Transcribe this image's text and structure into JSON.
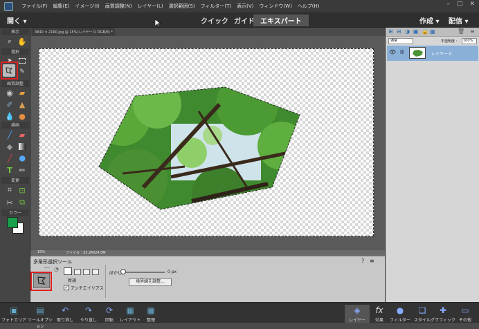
{
  "menubar": {
    "items": [
      "ファイル(F)",
      "編集(E)",
      "イメージ(I)",
      "画質調整(N)",
      "レイヤー(L)",
      "選択範囲(S)",
      "フィルター(T)",
      "表示(V)",
      "ウィンドウ(W)",
      "ヘルプ(H)"
    ]
  },
  "modebar": {
    "open_label": "開く ▾",
    "tabs": [
      "クイック",
      "ガイド",
      "エキスパート"
    ],
    "create_label": "作成 ▾",
    "share_label": "配信 ▾"
  },
  "toolbox": {
    "sections": [
      "表示",
      "選択",
      "画質調整",
      "描画",
      "変更",
      "カラー"
    ]
  },
  "document": {
    "tab_label": "3840 × 2160.jpg @ 15%(レイヤー 0, RGB/8) *",
    "zoom": "15%",
    "file_info": "ファイル : 33.2M/24.0M"
  },
  "tool_options": {
    "tool_name": "多角形選択ツール",
    "new_label": "新規",
    "antialias_label": "アンチエイリアス",
    "feather_label": "ぼかし :",
    "feather_value": "0 px",
    "refine_edge_button": "境界線を調整..."
  },
  "layers_panel": {
    "blend_mode": "通常",
    "opacity_label": "不透明度 :",
    "opacity_value": "100%",
    "layer_name": "レイヤー 0"
  },
  "bottombar": {
    "items": [
      "フォトエリア",
      "ツールオプション",
      "取り消し",
      "やり直し",
      "回転",
      "レイアウト",
      "整理",
      "レイヤー",
      "効果",
      "フィルター",
      "スタイル",
      "グラフィック",
      "その他"
    ]
  },
  "colors": {
    "foreground": "#1aa04a",
    "background": "#ffffff",
    "highlight": "#e02020"
  }
}
